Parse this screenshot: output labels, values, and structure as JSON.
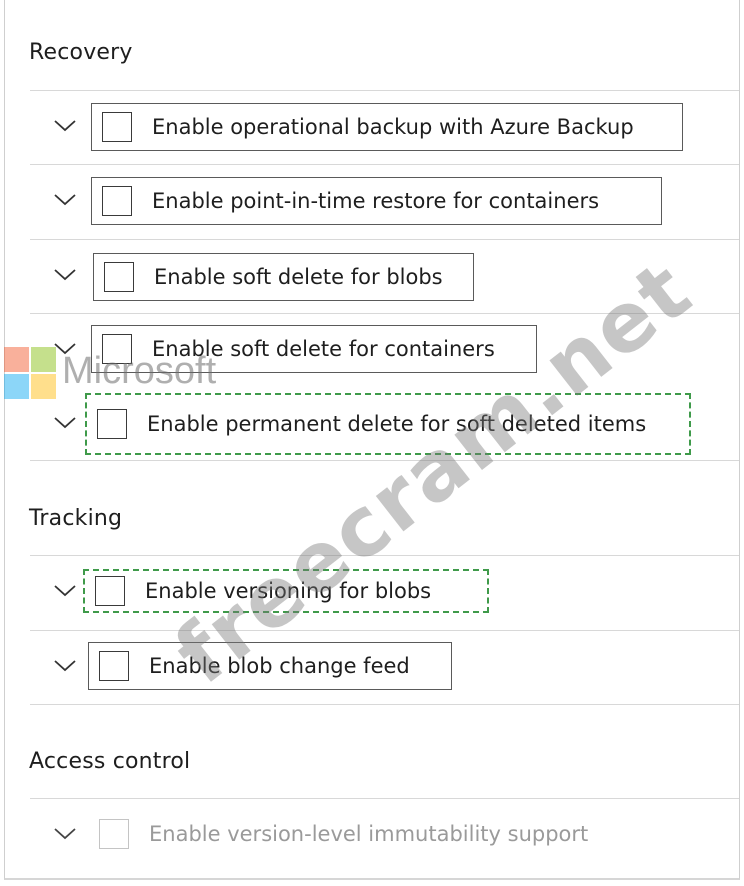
{
  "sections": [
    {
      "heading": "Recovery",
      "options": [
        {
          "label": "Enable operational backup with Azure Backup",
          "checked": false
        },
        {
          "label": "Enable point-in-time restore for containers",
          "checked": false
        },
        {
          "label": "Enable soft delete for blobs",
          "checked": false
        },
        {
          "label": "Enable soft delete for containers",
          "checked": false
        },
        {
          "label": "Enable permanent delete for soft deleted items",
          "checked": false
        }
      ]
    },
    {
      "heading": "Tracking",
      "options": [
        {
          "label": "Enable versioning for blobs",
          "checked": false
        },
        {
          "label": "Enable blob change feed",
          "checked": false
        }
      ]
    },
    {
      "heading": "Access control",
      "options": [
        {
          "label": "Enable version-level immutability support",
          "checked": false,
          "disabled": true
        }
      ]
    }
  ],
  "icons": {
    "expand": "chevron-down-icon",
    "checkbox": "checkbox-icon"
  },
  "colors": {
    "highlight_border": "#3f9a4a",
    "box_border": "#5a5a5a",
    "disabled_text": "#9a9a9a"
  },
  "watermark": {
    "text": "freecram.net",
    "brand": "Microsoft"
  }
}
